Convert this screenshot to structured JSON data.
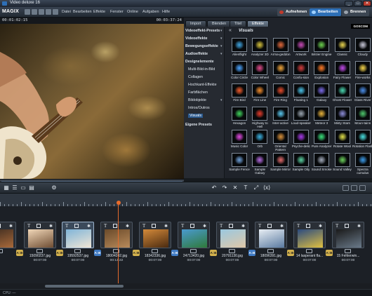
{
  "window": {
    "title": "Video deluxe 16",
    "min_glyph": "_",
    "max_glyph": "□",
    "close_glyph": "✕"
  },
  "menubar": {
    "logo": "MAGIX",
    "items": [
      "Datei",
      "Bearbeiten",
      "Effekte",
      "Fenster",
      "Online",
      "Aufgaben",
      "Hilfe"
    ],
    "mode_buttons": [
      {
        "label": "Aufnehmen",
        "color": "#c0392b"
      },
      {
        "label": "Bearbeiten",
        "color": "#2d6fb6"
      },
      {
        "label": "Brennen",
        "color": "#5b6573"
      }
    ]
  },
  "preview": {
    "timecode_left": "00:01:02:15",
    "timecode_right": "00:03:37:24"
  },
  "pool": {
    "tabs": [
      "Import",
      "Blenden",
      "Titel",
      "Effekte"
    ],
    "active_tab": "Effekte",
    "logo": "GOSCOM",
    "tree": [
      {
        "label": "Videoeffekt-Presets",
        "arrow": "▾",
        "level": 0
      },
      {
        "label": "Videoeffekte",
        "arrow": "▾",
        "level": 0
      },
      {
        "label": "Bewegungseffekte",
        "arrow": "▾",
        "level": 0
      },
      {
        "label": "Audioeffekte",
        "arrow": "▾",
        "level": 0
      },
      {
        "label": "Designelemente",
        "arrow": "",
        "level": 0
      },
      {
        "label": "Multi-Bild-in-Bild",
        "arrow": "",
        "level": 1
      },
      {
        "label": "Collagen",
        "arrow": "",
        "level": 1
      },
      {
        "label": "Hochkant-Effekte",
        "arrow": "",
        "level": 1
      },
      {
        "label": "Farbflächen",
        "arrow": "",
        "level": 1
      },
      {
        "label": "Bildobjekte",
        "arrow": "▾",
        "level": 1
      },
      {
        "label": "Intros/Outros",
        "arrow": "",
        "level": 1
      },
      {
        "label": "Visuals",
        "arrow": "",
        "level": 1,
        "selected": true
      },
      {
        "label": "Eigene Presets",
        "arrow": "",
        "level": 0
      }
    ],
    "grid_back": "«",
    "grid_title": "Visuals",
    "visuals": [
      {
        "label": "Alienflight",
        "color": "#3fa4e0"
      },
      {
        "label": "Analyzer 3D",
        "color": "#d6c23a"
      },
      {
        "label": "Arma-geddon",
        "color": "#e0683a"
      },
      {
        "label": "Artwork",
        "color": "#c64ab7"
      },
      {
        "label": "Bézier Engine",
        "color": "#6bd04e"
      },
      {
        "label": "Classic",
        "color": "#e8d44f"
      },
      {
        "label": "Cloudy",
        "color": "#c8c8d8"
      },
      {
        "label": "Color Circle",
        "color": "#4aa3ff"
      },
      {
        "label": "Color Wheel",
        "color": "#e04a8a"
      },
      {
        "label": "Comic",
        "color": "#f0a53a"
      },
      {
        "label": "Confu-sion",
        "color": "#d33d3d"
      },
      {
        "label": "Explosion",
        "color": "#ff7a26"
      },
      {
        "label": "Fairy Flower",
        "color": "#c04ae8"
      },
      {
        "label": "Fire-works",
        "color": "#f7d54a"
      },
      {
        "label": "Fire Bird",
        "color": "#ef5b2b"
      },
      {
        "label": "Fire Line",
        "color": "#f08a2b"
      },
      {
        "label": "Fire Ring",
        "color": "#e44a2a"
      },
      {
        "label": "Floating 1",
        "color": "#4ac2e8"
      },
      {
        "label": "Galaxy",
        "color": "#7a6ae8"
      },
      {
        "label": "Ghost Flower",
        "color": "#49d6b0"
      },
      {
        "label": "Glass River",
        "color": "#4a8de8"
      },
      {
        "label": "Hexagon",
        "color": "#3fd25b"
      },
      {
        "label": "Highway to Hell",
        "color": "#e23a2a"
      },
      {
        "label": "Inter-active",
        "color": "#5ac8f0"
      },
      {
        "label": "Loud-speaker",
        "color": "#9aa5b0"
      },
      {
        "label": "Meteor 3",
        "color": "#e8b23a"
      },
      {
        "label": "Misty Stars",
        "color": "#8c8cd8"
      },
      {
        "label": "Moun-tains",
        "color": "#4ec66b"
      },
      {
        "label": "Music Color",
        "color": "#e04ae0"
      },
      {
        "label": "Orb",
        "color": "#3ab0e0"
      },
      {
        "label": "Oriental Pattern",
        "color": "#d8903a"
      },
      {
        "label": "Psyche-delic",
        "color": "#a63ae8"
      },
      {
        "label": "Pure Analyzer",
        "color": "#3ae07a"
      },
      {
        "label": "Rotate Wool",
        "color": "#e0e04a"
      },
      {
        "label": "Rotation Flash",
        "color": "#4ae0e0"
      },
      {
        "label": "Sample Fence",
        "color": "#6fa0d8"
      },
      {
        "label": "Sample Galaxy",
        "color": "#b46ae0"
      },
      {
        "label": "Sample Mirror",
        "color": "#e06a6a"
      },
      {
        "label": "Sample Oily",
        "color": "#5ad0a0"
      },
      {
        "label": "Sound Smoke",
        "color": "#a0a8b8"
      },
      {
        "label": "Sound Valley",
        "color": "#6ad05a"
      },
      {
        "label": "Spectra cumulus",
        "color": "#3a9ae8"
      }
    ]
  },
  "toolbar": {
    "left_tools": [
      {
        "name": "storyboard-mode-icon",
        "glyph": "▦"
      },
      {
        "name": "timeline-mode-icon",
        "glyph": "☰"
      },
      {
        "name": "scene-mode-icon",
        "glyph": "▭"
      },
      {
        "name": "overview-mode-icon",
        "glyph": "▤"
      },
      {
        "name": "settings-icon",
        "glyph": "⚙"
      }
    ],
    "mid_tools": [
      {
        "name": "undo-icon",
        "glyph": "↶"
      },
      {
        "name": "redo-icon",
        "glyph": "↷"
      },
      {
        "name": "delete-icon",
        "glyph": "✕"
      },
      {
        "name": "title-icon",
        "glyph": "T"
      },
      {
        "name": "marker-icon",
        "glyph": "⤢"
      },
      {
        "name": "fx-icon",
        "glyph": "⟨x⟩"
      }
    ]
  },
  "transport": {
    "buttons": [
      "⏮",
      "◀",
      "⏪",
      "▶",
      "⏩",
      "⏹",
      "●"
    ]
  },
  "clips": [
    {
      "name": "",
      "dur": "",
      "tint": [
        "#3a2a20",
        "#aa6a3a"
      ]
    },
    {
      "name": "15090237.jpg",
      "dur": "00:07:00",
      "tint": [
        "#f1d7b8",
        "#6e4d33"
      ]
    },
    {
      "name": "19592537.jpg",
      "dur": "00:07:00",
      "tint": [
        "#7fb4d8",
        "#f1e6d6"
      ],
      "selected": true
    },
    {
      "name": "18004242.jpg",
      "dur": "00:13:22",
      "tint": [
        "#6a4a2a",
        "#b88a5a"
      ]
    },
    {
      "name": "18342336.jpg",
      "dur": "00:07:00",
      "tint": [
        "#d48a3a",
        "#4a2a10"
      ]
    },
    {
      "name": "24713420.jpg",
      "dur": "00:07:00",
      "tint": [
        "#4a9ad0",
        "#2f7a3a"
      ]
    },
    {
      "name": "20791130.jpg",
      "dur": "00:07:00",
      "tint": [
        "#9ac8e0",
        "#e0c8a8"
      ]
    },
    {
      "name": "18096391.jpg",
      "dur": "00:07:00",
      "tint": [
        "#e8eef4",
        "#5a7aa0"
      ]
    },
    {
      "name": "14 lasperant fla...",
      "dur": "00:07:00",
      "tint": [
        "#2a4a80",
        "#e0c040"
      ]
    },
    {
      "name": "15 Fehlerwin...",
      "dur": "00:07:00",
      "tint": [
        "#1a1a1a",
        "#6a7a8a"
      ]
    }
  ],
  "transitions": [
    {
      "label": "A↕B",
      "style": "yellow"
    },
    {
      "label": "A↕B",
      "style": "yellow"
    },
    {
      "label": "A↕B",
      "style": "blue"
    },
    {
      "label": "A↕B",
      "style": "yellow"
    },
    {
      "label": "A↕B",
      "style": "blue"
    },
    {
      "label": "A↕B",
      "style": "yellow"
    },
    {
      "label": "A↕B",
      "style": "blue"
    },
    {
      "label": "A↕B",
      "style": "yellow"
    },
    {
      "label": "A↕B",
      "style": "yellow"
    }
  ],
  "status": {
    "cpu": "CPU: —"
  }
}
